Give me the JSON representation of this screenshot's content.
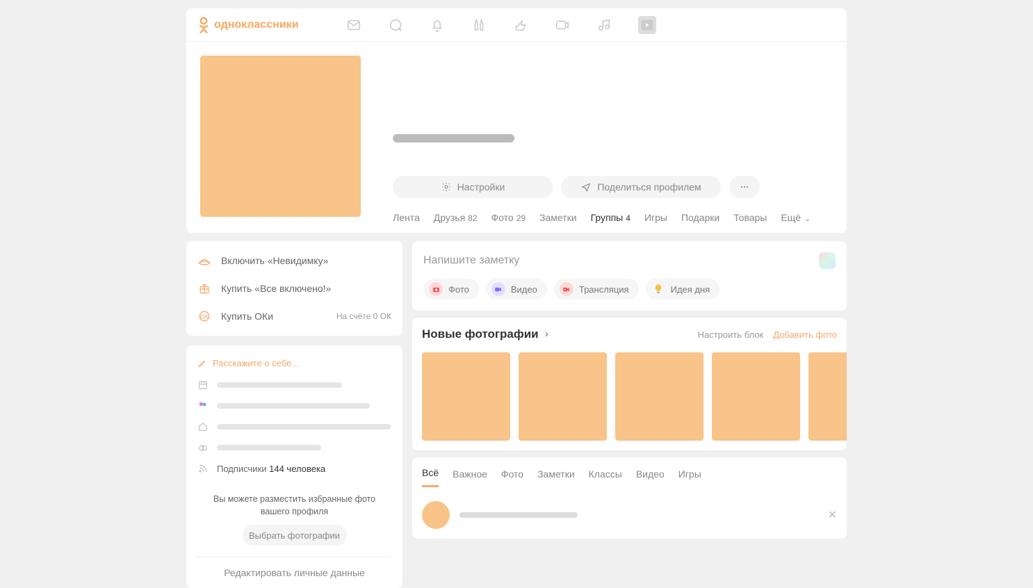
{
  "brand": "одноклассники",
  "profile": {
    "settings_label": "Настройки",
    "share_label": "Поделиться профилем"
  },
  "nav_tabs": [
    {
      "label": "Лента",
      "count": "",
      "active": false
    },
    {
      "label": "Друзья",
      "count": "82",
      "active": false
    },
    {
      "label": "Фото",
      "count": "29",
      "active": false
    },
    {
      "label": "Заметки",
      "count": "",
      "active": false
    },
    {
      "label": "Группы",
      "count": "4",
      "active": true
    },
    {
      "label": "Игры",
      "count": "",
      "active": false
    },
    {
      "label": "Подарки",
      "count": "",
      "active": false
    },
    {
      "label": "Товары",
      "count": "",
      "active": false
    },
    {
      "label": "Ещё",
      "count": "",
      "active": false,
      "more": true
    }
  ],
  "promo": [
    {
      "label": "Включить «Невидимку»",
      "icon": "hat"
    },
    {
      "label": "Купить «Все включено!»",
      "icon": "gift"
    },
    {
      "label": "Купить ОКи",
      "icon": "coin",
      "extra": "На счёте 0 ОК"
    }
  ],
  "about": {
    "hint": "Расскажите о себе...",
    "subscribers_prefix": "Подписчики ",
    "subscribers_count": "144 человека",
    "photo_hint": "Вы можете разместить избранные фото вашего профиля",
    "select_photos": "Выбрать фотографии",
    "edit_link": "Редактировать личные данные"
  },
  "compose": {
    "placeholder": "Напишите заметку",
    "chips": {
      "photo": "Фото",
      "video": "Видео",
      "stream": "Трансляция",
      "idea": "Идея дня"
    }
  },
  "photos_block": {
    "title": "Новые фотографии",
    "configure": "Настроить блок",
    "add": "Добавить фото"
  },
  "feed_tabs": [
    "Всё",
    "Важное",
    "Фото",
    "Заметки",
    "Классы",
    "Видео",
    "Игры"
  ]
}
